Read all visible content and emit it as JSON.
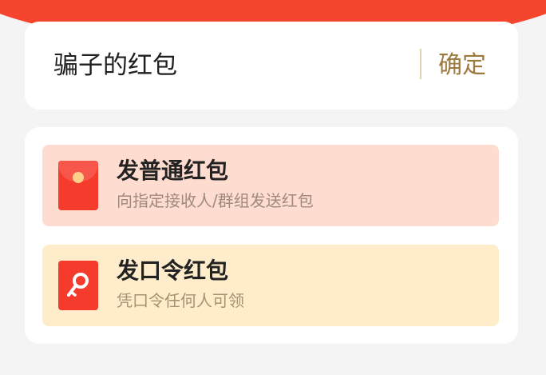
{
  "input": {
    "value": "骗子的红包",
    "confirm_label": "确定"
  },
  "options": [
    {
      "title": "发普通红包",
      "subtitle": "向指定接收人/群组发送红包",
      "icon": "red-envelope-icon"
    },
    {
      "title": "发口令红包",
      "subtitle": "凭口令任何人可领",
      "icon": "key-icon"
    }
  ],
  "colors": {
    "header": "#f5452f",
    "confirm": "#9c7a3e",
    "normal_bg": "#fedcd0",
    "password_bg": "#feeccb",
    "icon_red": "#f43b2c"
  }
}
